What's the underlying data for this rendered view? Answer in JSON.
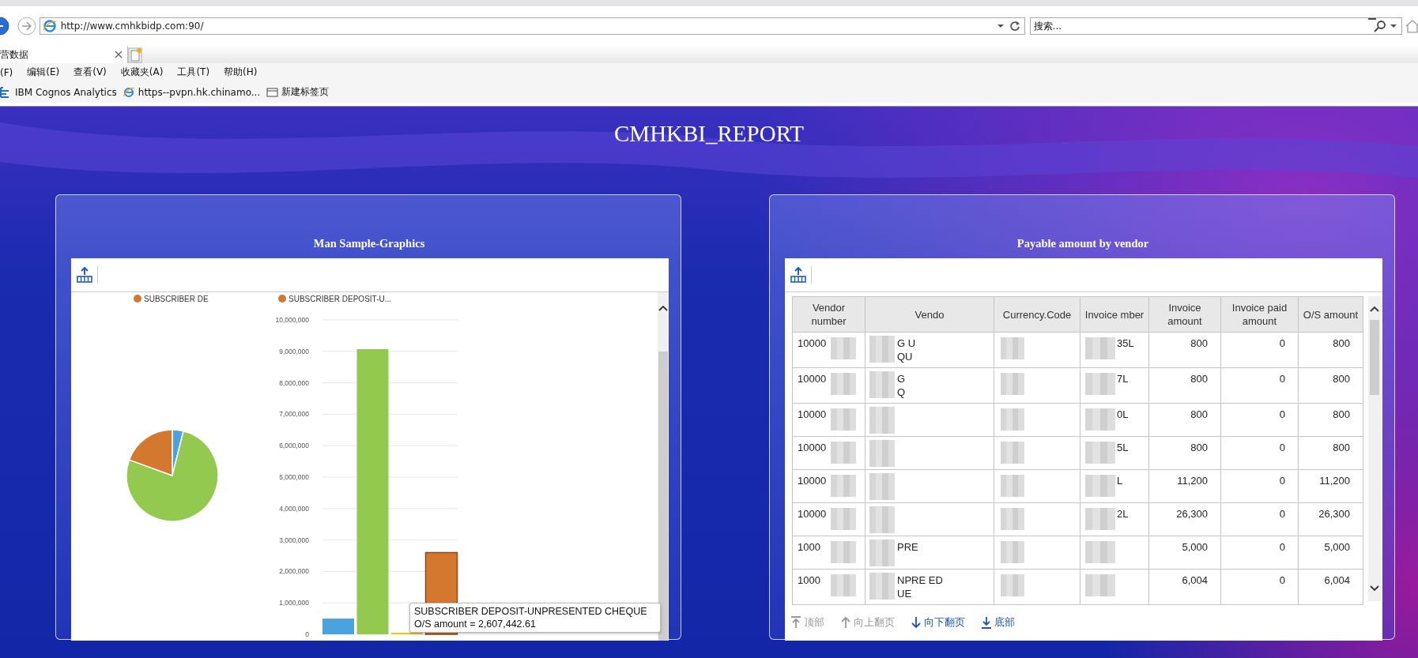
{
  "browser": {
    "address": "http://www.cmhkbidp.com:90/",
    "search": {
      "placeholder": "搜索..."
    },
    "tab": {
      "title": "营数据",
      "selected": true
    },
    "menu": [
      "(F)",
      "编辑(E)",
      "查看(V)",
      "收藏夹(A)",
      "工具(T)",
      "帮助(H)"
    ],
    "favorites": [
      {
        "label": "IBM Cognos Analytics",
        "kind": "cognos"
      },
      {
        "label": "https--pvpn.hk.chinamo...",
        "kind": "ie"
      },
      {
        "label": "新建标签页",
        "kind": "page"
      }
    ]
  },
  "report": {
    "title": "CMHKBI_REPORT"
  },
  "panels": [
    {
      "kind": "chart",
      "title": "Man Sample-Graphics",
      "legend": [
        {
          "label": "SUBSCRIBER DE",
          "color": "#d4782f"
        },
        {
          "label": "SUBSCRIBER DEPOSIT-U...",
          "color": "#d4782f"
        }
      ],
      "chart_data": {
        "type": "bar",
        "grid": true,
        "ylim": [
          0,
          10000000
        ],
        "yticks": [
          {
            "value": 0,
            "label": "0"
          },
          {
            "value": 1000000,
            "label": "1,000,000"
          },
          {
            "value": 2000000,
            "label": "2,000,000"
          },
          {
            "value": 3000000,
            "label": "3,000,000"
          },
          {
            "value": 4000000,
            "label": "4,000,000"
          },
          {
            "value": 5000000,
            "label": "5,000,000"
          },
          {
            "value": 6000000,
            "label": "6,000,000"
          },
          {
            "value": 7000000,
            "label": "7,000,000"
          },
          {
            "value": 8000000,
            "label": "8,000,000"
          },
          {
            "value": 9000000,
            "label": "9,000,000"
          },
          {
            "value": 10000000,
            "label": "10,000,000"
          }
        ],
        "series": [
          {
            "color": "#4aa3df",
            "values": [
              500000,
              null,
              null,
              null
            ]
          },
          {
            "color": "#93c94f",
            "values": [
              null,
              9070000,
              null,
              null
            ]
          },
          {
            "color": "#f0c419",
            "values": [
              null,
              null,
              50000,
              null
            ]
          },
          {
            "color": "#d4782f",
            "values": [
              null,
              null,
              null,
              2600000
            ]
          }
        ]
      },
      "tooltip": {
        "title": "SUBSCRIBER DEPOSIT-UNPRESENTED CHEQUE",
        "value": "O/S amount = 2,607,442.61"
      }
    },
    {
      "kind": "table",
      "title": "Payable amount by vendor",
      "table": {
        "columns": [
          "Vendor number",
          "Vendo",
          "Currency.Code",
          "Invoice mber",
          "Invoice amount",
          "Invoice paid amount",
          "O/S amount"
        ],
        "rows": [
          {
            "vendor_number": "10000",
            "vendor_name": [
              "G U",
              "QU"
            ],
            "invoice_number": "35L",
            "invoice_amount": "800",
            "paid_amount": "0",
            "os_amount": "800"
          },
          {
            "vendor_number": "10000",
            "vendor_name": [
              "G",
              "Q"
            ],
            "invoice_number": "7L",
            "invoice_amount": "800",
            "paid_amount": "0",
            "os_amount": "800"
          },
          {
            "vendor_number": "10000",
            "invoice_number": "0L",
            "invoice_amount": "800",
            "paid_amount": "0",
            "os_amount": "800"
          },
          {
            "vendor_number": "10000",
            "invoice_number": "5L",
            "invoice_amount": "800",
            "paid_amount": "0",
            "os_amount": "800"
          },
          {
            "vendor_number": "10000",
            "invoice_number": "L",
            "invoice_amount": "11,200",
            "paid_amount": "0",
            "os_amount": "11,200"
          },
          {
            "vendor_number": "10000",
            "invoice_number": "2L",
            "invoice_amount": "26,300",
            "paid_amount": "0",
            "os_amount": "26,300"
          },
          {
            "vendor_number": "1000",
            "vendor_name": [
              "PRE"
            ],
            "invoice_amount": "5,000",
            "paid_amount": "0",
            "os_amount": "5,000"
          },
          {
            "vendor_number": "1000",
            "vendor_name": [
              "NPRE ED",
              "UE"
            ],
            "invoice_amount": "6,004",
            "paid_amount": "0",
            "os_amount": "6,004"
          }
        ]
      },
      "pager": [
        {
          "label": "顶部",
          "kind": "top",
          "disabled": true
        },
        {
          "label": "向上翻页",
          "kind": "up",
          "disabled": true
        },
        {
          "label": "向下翻页",
          "kind": "down",
          "disabled": false
        },
        {
          "label": "底部",
          "kind": "bottom",
          "disabled": false
        }
      ]
    }
  ]
}
